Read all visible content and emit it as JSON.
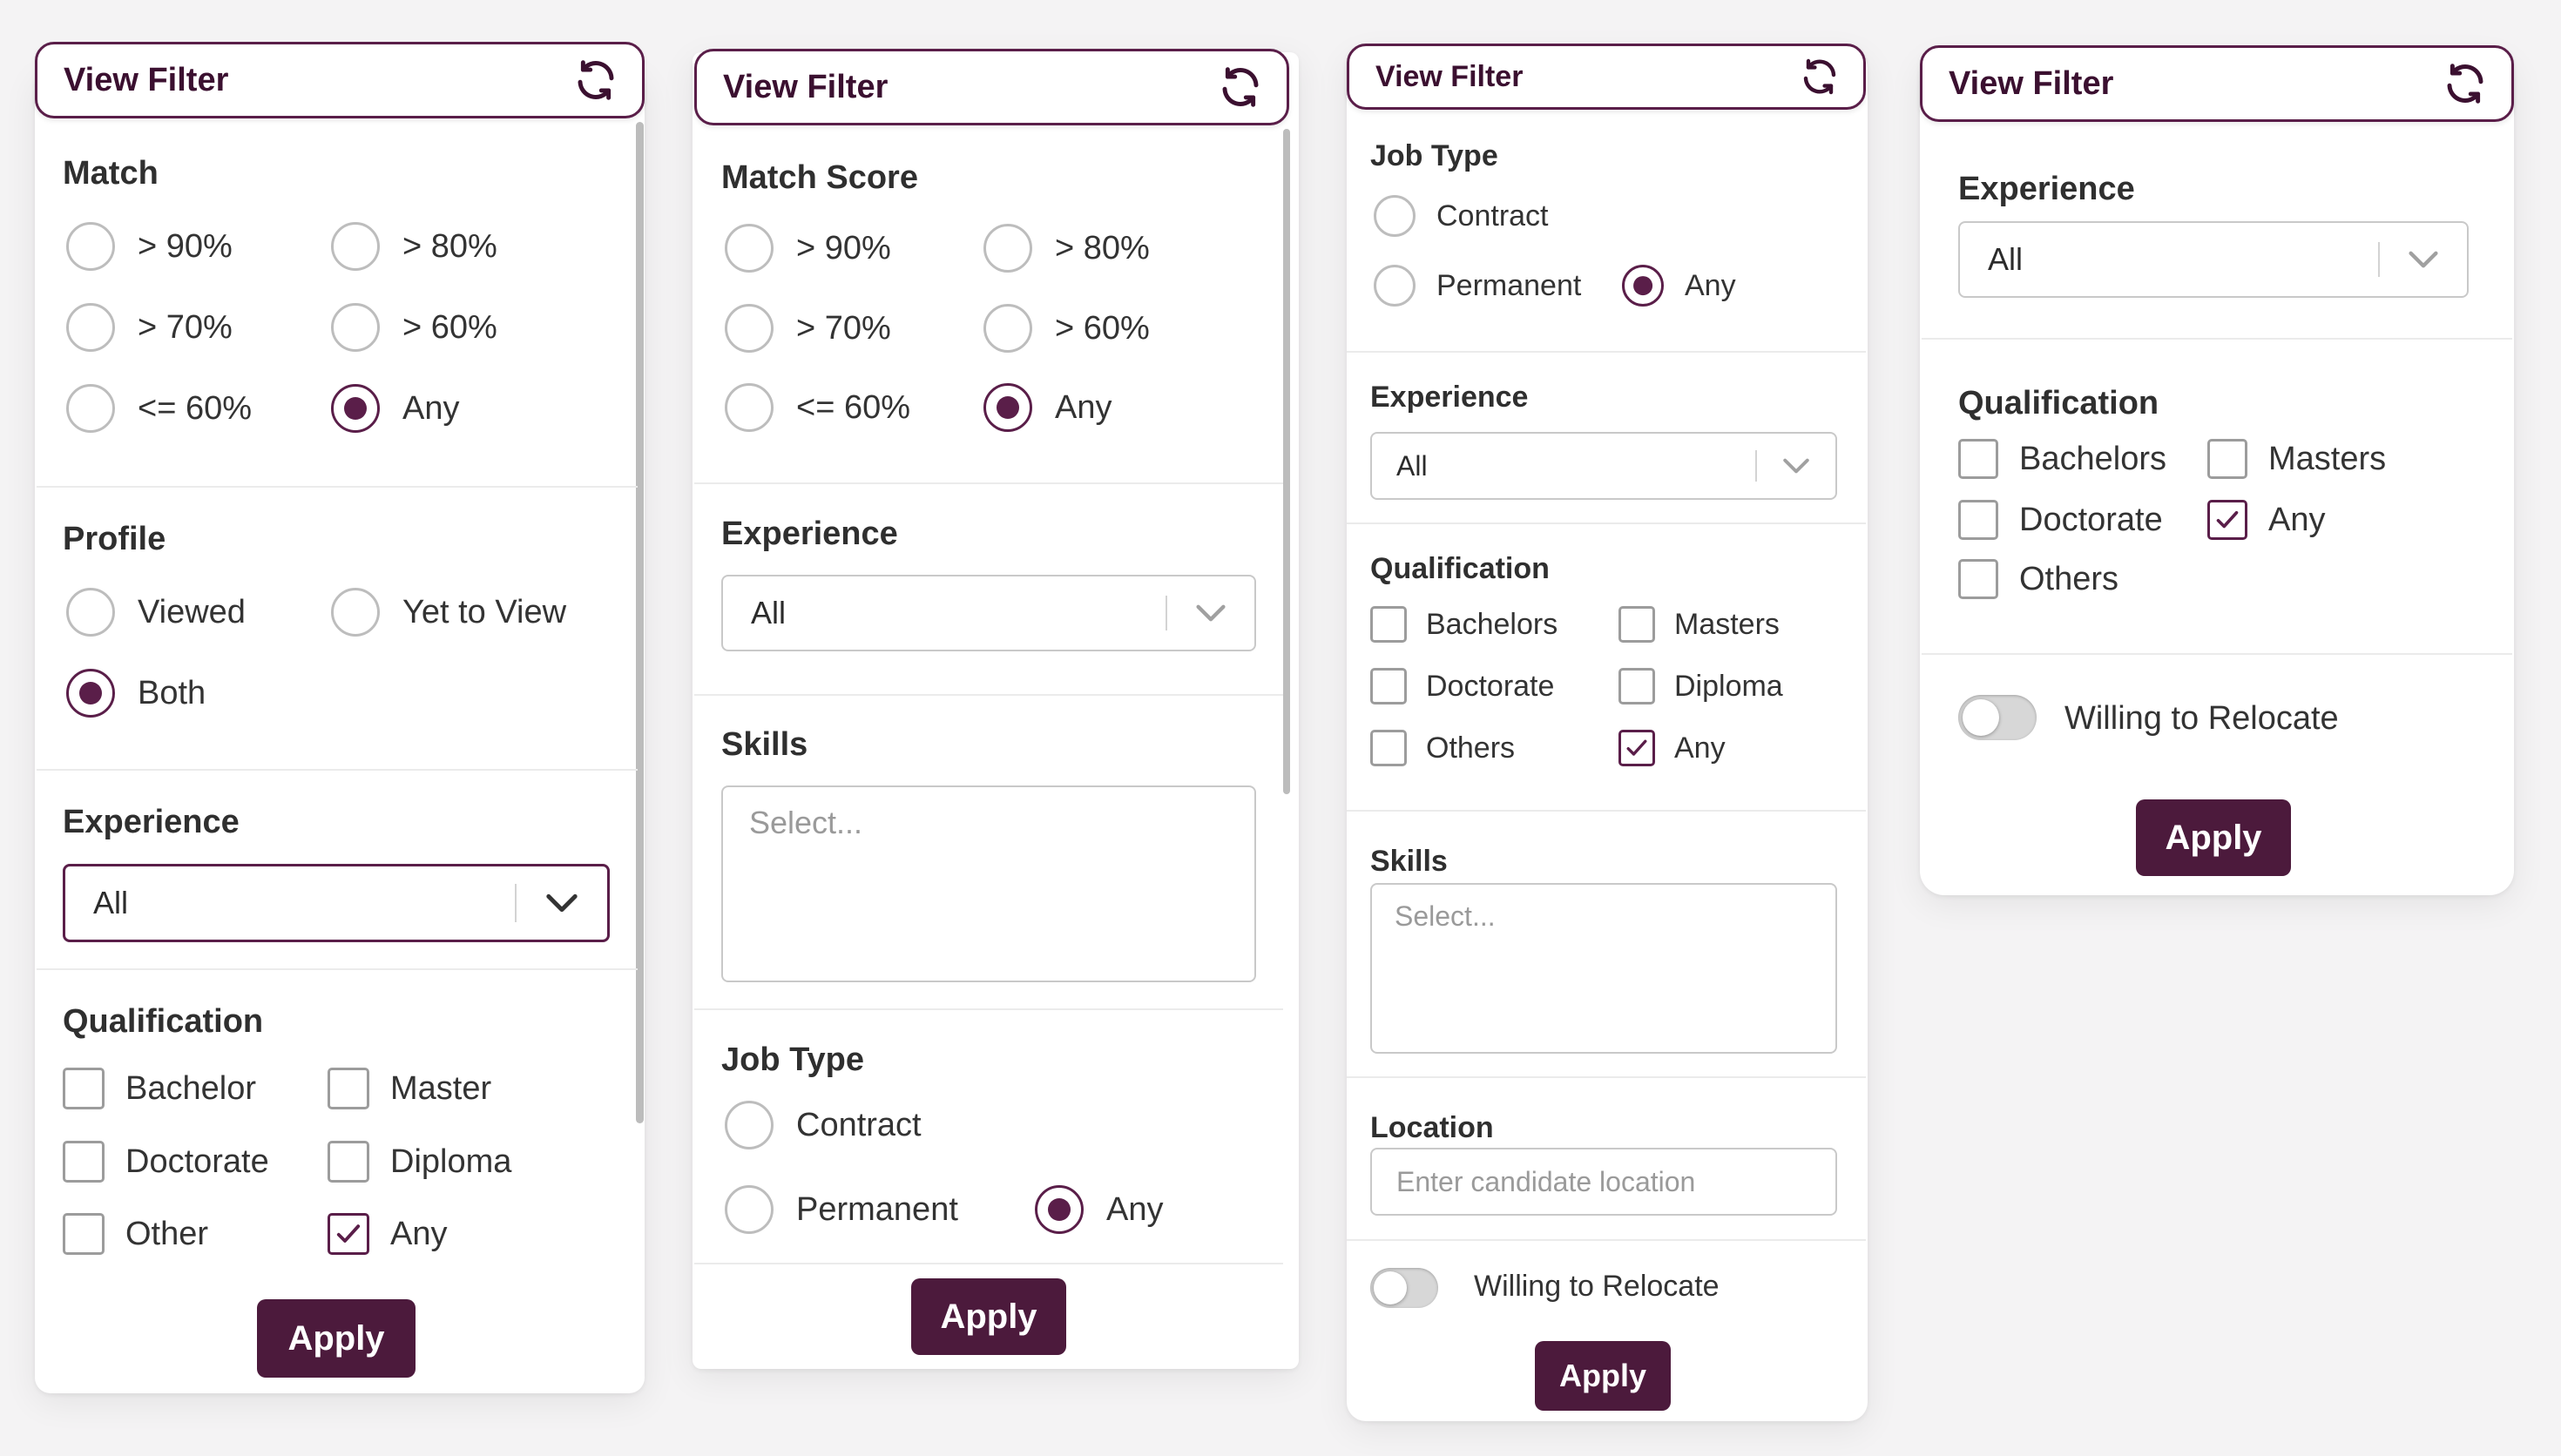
{
  "colors": {
    "accent": "#5a1e49",
    "apply_button": "#4c1a3c",
    "border": "#c9c9c9"
  },
  "icons": {
    "refresh": "refresh-icon",
    "chevron": "chevron-down-icon",
    "check": "checkmark-icon"
  },
  "panel1": {
    "title": "View Filter",
    "match": {
      "title": "Match",
      "options": [
        "> 90%",
        "> 80%",
        "> 70%",
        "> 60%",
        "<= 60%",
        "Any"
      ],
      "selected": "Any"
    },
    "profile": {
      "title": "Profile",
      "options": [
        "Viewed",
        "Yet to View",
        "Both"
      ],
      "selected": "Both"
    },
    "experience": {
      "title": "Experience",
      "value": "All"
    },
    "qualification": {
      "title": "Qualification",
      "options": [
        "Bachelor",
        "Master",
        "Doctorate",
        "Diploma",
        "Other",
        "Any"
      ],
      "checked": [
        "Any"
      ]
    },
    "apply": "Apply"
  },
  "panel2": {
    "title": "View Filter",
    "match_score": {
      "title": "Match Score",
      "options": [
        "> 90%",
        "> 80%",
        "> 70%",
        "> 60%",
        "<= 60%",
        "Any"
      ],
      "selected": "Any"
    },
    "experience": {
      "title": "Experience",
      "value": "All"
    },
    "skills": {
      "title": "Skills",
      "placeholder": "Select..."
    },
    "job_type": {
      "title": "Job Type",
      "options": [
        "Contract",
        "Permanent",
        "Any"
      ],
      "selected": "Any"
    },
    "apply": "Apply"
  },
  "panel3": {
    "title": "View Filter",
    "job_type": {
      "title": "Job Type",
      "options": [
        "Contract",
        "Permanent",
        "Any"
      ],
      "selected": "Any"
    },
    "experience": {
      "title": "Experience",
      "value": "All"
    },
    "qualification": {
      "title": "Qualification",
      "options": [
        "Bachelors",
        "Masters",
        "Doctorate",
        "Diploma",
        "Others",
        "Any"
      ],
      "checked": [
        "Any"
      ]
    },
    "skills": {
      "title": "Skills",
      "placeholder": "Select..."
    },
    "location": {
      "title": "Location",
      "placeholder": "Enter candidate location"
    },
    "relocate": {
      "label": "Willing to Relocate",
      "on": false
    },
    "apply": "Apply"
  },
  "panel4": {
    "title": "View Filter",
    "experience": {
      "title": "Experience",
      "value": "All"
    },
    "qualification": {
      "title": "Qualification",
      "options": [
        "Bachelors",
        "Masters",
        "Doctorate",
        "Any",
        "Others"
      ],
      "checked": [
        "Any"
      ]
    },
    "relocate": {
      "label": "Willing to Relocate",
      "on": false
    },
    "apply": "Apply"
  }
}
